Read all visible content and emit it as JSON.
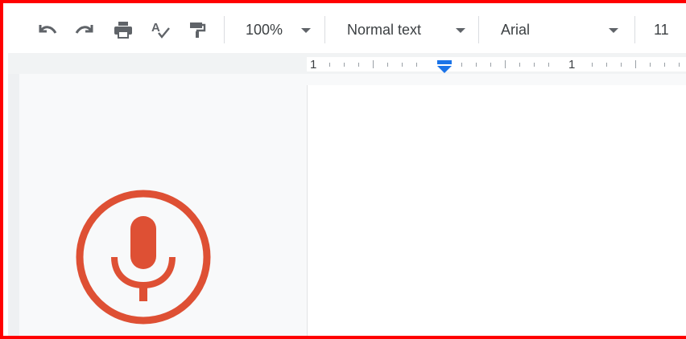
{
  "toolbar": {
    "zoom_value": "100%",
    "style_value": "Normal text",
    "font_value": "Arial",
    "font_size_value": "11"
  },
  "icons": {
    "undo": "undo-icon",
    "redo": "redo-icon",
    "print": "print-icon",
    "spellcheck": "spellcheck-icon",
    "paint_format": "paint-format-icon",
    "microphone": "microphone-icon"
  },
  "ruler": {
    "labels": [
      "1",
      "1"
    ]
  },
  "colors": {
    "accent": "#1a73e8",
    "mic": "#de5034",
    "frame": "#ff0000"
  }
}
